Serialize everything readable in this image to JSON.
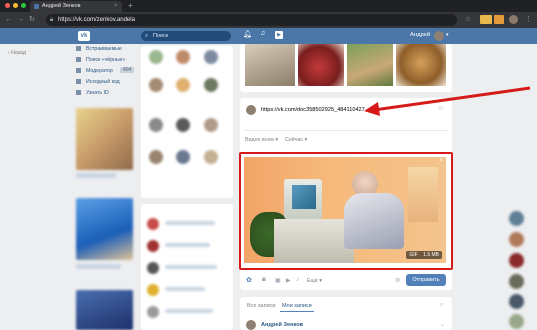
{
  "browser": {
    "tab_title": "Андрей Зенков",
    "url": "https://vk.com/zenkov.andela",
    "new_tab_glyph": "+"
  },
  "vk_header": {
    "search_placeholder": "Поиск",
    "user_name": "Андрей"
  },
  "left_menu": {
    "back_label": "Назад",
    "items": [
      {
        "label": "Встраиваемые"
      },
      {
        "label": "Поиск «чёрных»"
      },
      {
        "label": "Модератор",
        "badge": "404"
      },
      {
        "label": "Исходный код"
      },
      {
        "label": "Узнать ID"
      }
    ]
  },
  "composer": {
    "link_text": "https://vk.com/doc358502925_484110427",
    "visibility_label": "Видно всем ▾",
    "time_label": "Сейчас ▾",
    "attachment_badge_type": "GIF",
    "attachment_badge_size": "1.5 MB",
    "more_label": "Ещё ▾",
    "send_label": "Отправить"
  },
  "feed": {
    "tab_all": "Все записи",
    "tab_mine": "Мои записи",
    "post_author": "Андрей Зенков"
  },
  "colors": {
    "vk_blue": "#4a76a8",
    "annotation_red": "#d61a1a",
    "send_button": "#5181b8"
  },
  "icons": [
    "back-arrow-icon",
    "forward-arrow-icon",
    "reload-icon",
    "lock-icon",
    "star-icon",
    "vk-logo-icon",
    "search-icon",
    "bell-icon",
    "music-icon",
    "play-icon",
    "camera-icon",
    "photo-icon",
    "video-icon",
    "audio-icon",
    "document-icon",
    "close-icon",
    "gear-icon",
    "chevron-down-icon"
  ]
}
